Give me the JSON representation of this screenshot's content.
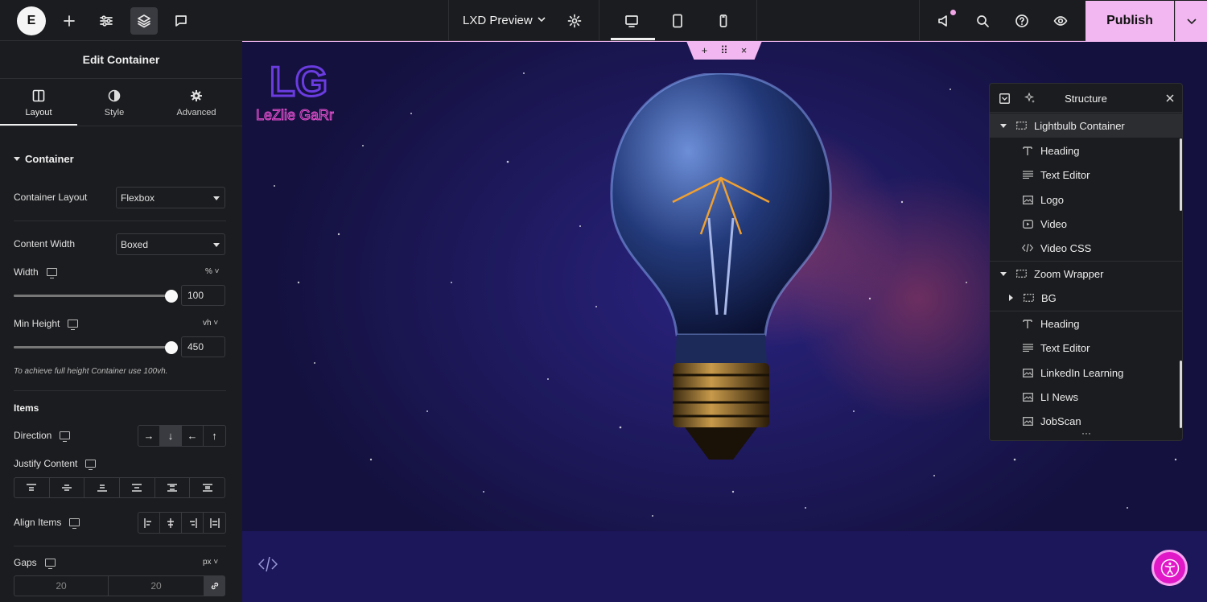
{
  "topbar": {
    "logo_letter": "E",
    "preview_title": "LXD Preview",
    "publish_label": "Publish"
  },
  "panel": {
    "title": "Edit Container",
    "tabs": [
      {
        "label": "Layout"
      },
      {
        "label": "Style"
      },
      {
        "label": "Advanced"
      }
    ],
    "section_title": "Container",
    "container_layout": {
      "label": "Container Layout",
      "value": "Flexbox"
    },
    "content_width": {
      "label": "Content Width",
      "value": "Boxed"
    },
    "width": {
      "label": "Width",
      "unit": "%",
      "value": "100"
    },
    "min_height": {
      "label": "Min Height",
      "unit": "vh",
      "value": "450"
    },
    "hint": "To achieve full height Container use 100vh.",
    "items_title": "Items",
    "direction_label": "Direction",
    "direction_options": [
      "→",
      "↓",
      "←",
      "↑"
    ],
    "justify_label": "Justify Content",
    "align_label": "Align Items",
    "gaps": {
      "label": "Gaps",
      "unit": "px",
      "column": "20",
      "row": "20"
    }
  },
  "structure": {
    "title": "Structure",
    "items": [
      {
        "label": "Lightbulb Container"
      },
      {
        "label": "Heading"
      },
      {
        "label": "Text Editor"
      },
      {
        "label": "Logo"
      },
      {
        "label": "Video"
      },
      {
        "label": "Video CSS"
      },
      {
        "label": "Zoom Wrapper"
      },
      {
        "label": "BG"
      },
      {
        "label": "Heading"
      },
      {
        "label": "Text Editor"
      },
      {
        "label": "LinkedIn Learning"
      },
      {
        "label": "LI News"
      },
      {
        "label": "JobScan"
      }
    ],
    "more": "···"
  },
  "canvas": {
    "logo_text": "LeZlie GaRr",
    "logo_monogram": "LG",
    "handle_add": "+",
    "handle_move": "⠿",
    "handle_close": "×"
  },
  "colors": {
    "accent": "#f2b7f0",
    "panel_bg": "#1b1c1f",
    "a11y": "#e018c8"
  }
}
